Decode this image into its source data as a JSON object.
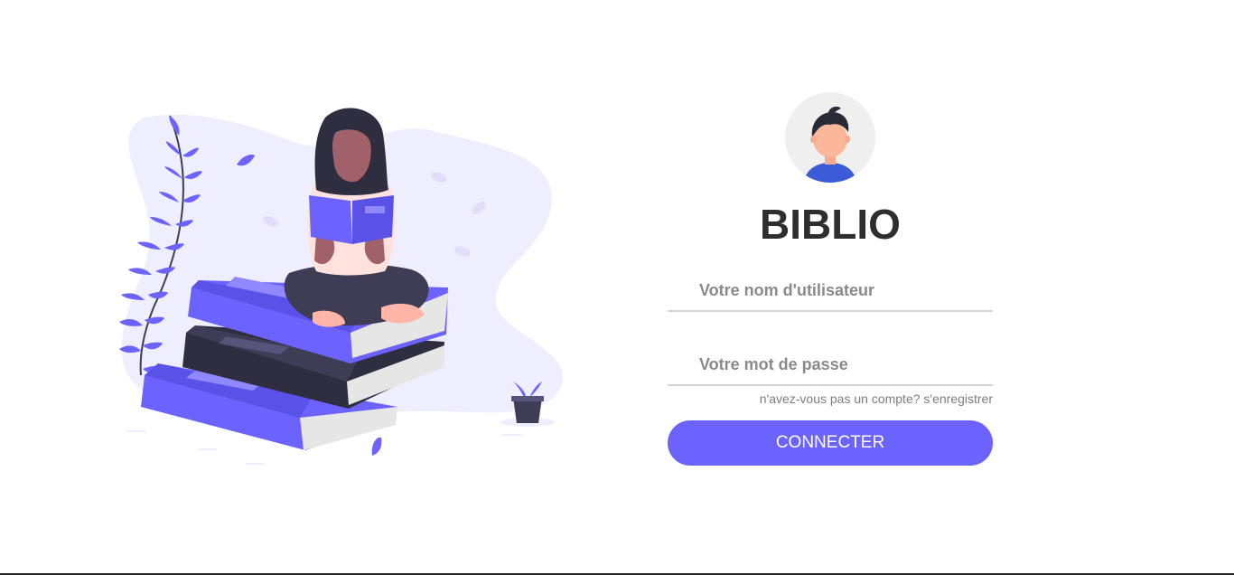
{
  "login": {
    "brand": "BIBLIO",
    "username_placeholder": "Votre nom d'utilisateur",
    "password_placeholder": "Votre mot de passe",
    "register_link": "n'avez-vous pas un compte? s'enregistrer",
    "connect_button": "CONNECTER"
  },
  "icons": {
    "illustration": "woman-reading-on-books-illustration",
    "avatar": "user-avatar-icon"
  },
  "colors": {
    "accent": "#6c63ff",
    "title": "#2e2e2e",
    "muted_text": "#8a8a8a",
    "input_border": "#d3d3d3",
    "avatar_bg": "#efefef"
  }
}
